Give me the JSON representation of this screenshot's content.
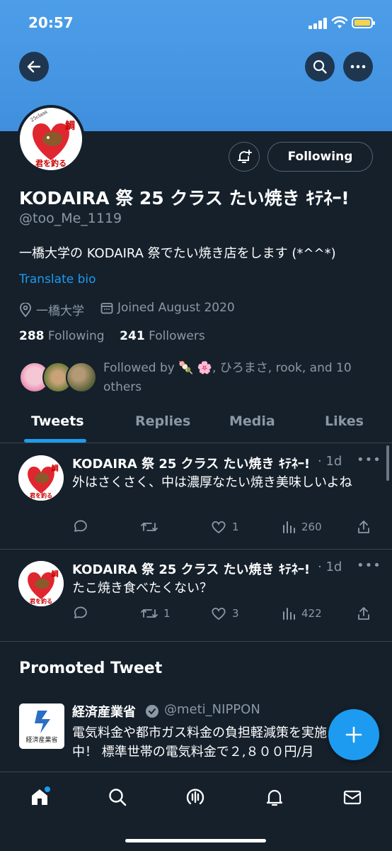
{
  "status_bar": {
    "time": "20:57"
  },
  "profile": {
    "name": "KODAIRA 祭 25 クラス たい焼き ｷﾃﾈｰ!",
    "handle": "@too_Me_1119",
    "bio": "一橋大学の KODAIRA 祭でたい焼き店をします (*^^*)",
    "translate_label": "Translate bio",
    "location": "一橋大学",
    "joined": "Joined August 2020",
    "following_count": "288",
    "following_label": "Following",
    "followers_count": "241",
    "followers_label": "Followers",
    "followed_by": "Followed by 🍡 🌸, ひろまさ, rook, and 10 others",
    "following_button": "Following",
    "avatar_text": {
      "top": "25class presents",
      "mid": "鯛",
      "bottom": "君を釣る"
    }
  },
  "tabs": [
    {
      "label": "Tweets"
    },
    {
      "label": "Replies"
    },
    {
      "label": "Media"
    },
    {
      "label": "Likes"
    }
  ],
  "tweets": [
    {
      "name": "KODAIRA 祭 25 クラス たい焼き ｷﾃﾈｰ!",
      "time": "· 1d",
      "text": "外はさくさく、中は濃厚なたい焼き美味しいよね",
      "replies": "",
      "retweets": "",
      "likes": "1",
      "views": "260"
    },
    {
      "name": "KODAIRA 祭 25 クラス たい焼き ｷﾃﾈｰ!",
      "time": "· 1d",
      "text": "たこ焼き食べたくない？",
      "replies": "",
      "retweets": "1",
      "likes": "3",
      "views": "422"
    }
  ],
  "promoted": {
    "section_title": "Promoted Tweet",
    "name": "経済産業省",
    "handle": "@meti_NIPPON",
    "logo_text": "経済産業省",
    "text": "電気料金や都市ガス料金の負担軽減策を実施中！ 標準世帯の電気料金で２,８００円/月"
  },
  "colors": {
    "background": "#15202b",
    "banner": "#4d9ee9",
    "accent": "#1d9bf0",
    "muted": "#8b98a5",
    "divider": "#38444d"
  },
  "icons": {
    "back": "back-arrow-icon",
    "search": "search-icon",
    "more": "more-icon",
    "bell": "bell-plus-icon",
    "fab": "compose-plus-icon"
  },
  "bottom_nav": [
    "home-icon",
    "explore-icon",
    "spaces-icon",
    "notifications-icon",
    "messages-icon"
  ]
}
